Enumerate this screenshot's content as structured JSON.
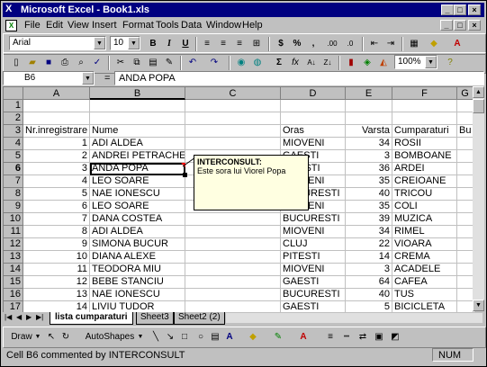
{
  "window": {
    "title": "Microsoft Excel - Book1.xls"
  },
  "menu": [
    "File",
    "Edit",
    "View",
    "Insert",
    "Format",
    "Tools",
    "Data",
    "Window",
    "Help"
  ],
  "formatting": {
    "font": "Arial",
    "size": "10"
  },
  "standard": {
    "zoom": "100%"
  },
  "formula_bar": {
    "name_box": "B6",
    "equals": "=",
    "content": "ANDA POPA"
  },
  "columns": [
    "A",
    "B",
    "C",
    "D",
    "E",
    "F",
    "G"
  ],
  "rows": [
    {
      "n": "1",
      "a": "",
      "b": "",
      "d": "",
      "e": "",
      "f": ""
    },
    {
      "n": "2",
      "a": "",
      "b": "",
      "d": "",
      "e": "",
      "f": ""
    },
    {
      "n": "3",
      "a": "Nr.inregistrare",
      "b": "Nume",
      "d": "Oras",
      "e": "Varsta",
      "f": "Cumparaturi",
      "g": "Bu"
    },
    {
      "n": "4",
      "a": "1",
      "b": "ADI ALDEA",
      "d": "MIOVENI",
      "e": "34",
      "f": "ROSII"
    },
    {
      "n": "5",
      "a": "2",
      "b": "ANDREI PETRACHE",
      "d": "GAESTI",
      "e": "3",
      "f": "BOMBOANE"
    },
    {
      "n": "6",
      "a": "3",
      "b": "ANDA POPA",
      "d": "PITESTI",
      "e": "36",
      "f": "ARDEI"
    },
    {
      "n": "7",
      "a": "4",
      "b": "LEO SOARE",
      "d": "MIOVENI",
      "e": "35",
      "f": "CREIOANE"
    },
    {
      "n": "8",
      "a": "5",
      "b": "NAE IONESCU",
      "d": "BUCURESTI",
      "e": "40",
      "f": "TRICOU"
    },
    {
      "n": "9",
      "a": "6",
      "b": "LEO SOARE",
      "d": "MIOVENI",
      "e": "35",
      "f": "COLI"
    },
    {
      "n": "10",
      "a": "7",
      "b": "DANA COSTEA",
      "d": "BUCURESTI",
      "e": "39",
      "f": "MUZICA"
    },
    {
      "n": "11",
      "a": "8",
      "b": "ADI ALDEA",
      "d": "MIOVENI",
      "e": "34",
      "f": "RIMEL"
    },
    {
      "n": "12",
      "a": "9",
      "b": "SIMONA BUCUR",
      "d": "CLUJ",
      "e": "22",
      "f": "VIOARA"
    },
    {
      "n": "13",
      "a": "10",
      "b": "DIANA ALEXE",
      "d": "PITESTI",
      "e": "14",
      "f": "CREMA"
    },
    {
      "n": "14",
      "a": "11",
      "b": "TEODORA MIU",
      "d": "MIOVENI",
      "e": "3",
      "f": "ACADELE"
    },
    {
      "n": "15",
      "a": "12",
      "b": "BEBE STANCIU",
      "d": "GAESTI",
      "e": "64",
      "f": "CAFEA"
    },
    {
      "n": "16",
      "a": "13",
      "b": "NAE IONESCU",
      "d": "BUCURESTI",
      "e": "40",
      "f": "TUS"
    },
    {
      "n": "17",
      "a": "14",
      "b": "LIVIU TUDOR",
      "d": "GAESTI",
      "e": "5",
      "f": "BICICLETA"
    }
  ],
  "comment": {
    "author": "INTERCONSULT:",
    "text": "Este sora lui Viorel Popa"
  },
  "sheet_tabs": [
    "lista cumparaturi",
    "Sheet3",
    "Sheet2 (2)"
  ],
  "drawing": {
    "draw": "Draw",
    "autoshapes": "AutoShapes"
  },
  "status": {
    "text": "Cell B6 commented by INTERCONSULT",
    "num": "NUM"
  },
  "colors": {
    "title_bar": "#000080",
    "comment_bg": "#ffffe1",
    "face": "#c0c0c0"
  }
}
